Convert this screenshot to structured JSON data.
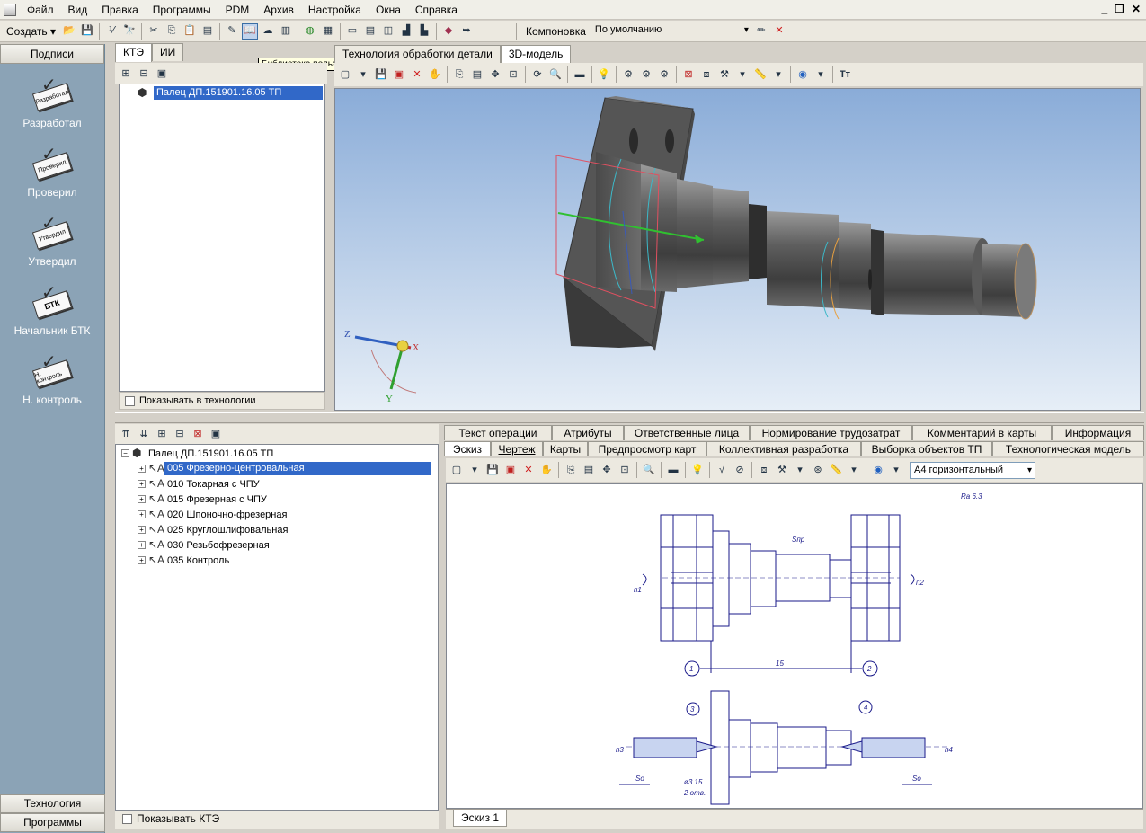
{
  "menu": {
    "items": [
      "Файл",
      "Вид",
      "Правка",
      "Программы",
      "PDM",
      "Архив",
      "Настройка",
      "Окна",
      "Справка"
    ]
  },
  "toolbar": {
    "create_label": "Создать",
    "layout_label": "Компоновка",
    "layout_value": "По умолчанию"
  },
  "tooltip": "Библиотека пользователей",
  "sidebar": {
    "header": "Подписи",
    "items": [
      {
        "label": "Разработал",
        "stamp": "Разработал"
      },
      {
        "label": "Проверил",
        "stamp": "Проверил"
      },
      {
        "label": "Утвердил",
        "stamp": "Утвердил"
      },
      {
        "label": "Начальник БТК",
        "stamp": "БТК"
      },
      {
        "label": "Н. контроль",
        "stamp": "Н. контроль"
      }
    ],
    "footer_tabs": [
      "Технология",
      "Программы"
    ]
  },
  "top_tabs": [
    "КТЭ",
    "ИИ"
  ],
  "top_tree": {
    "root": "Палец ДП.151901.16.05  ТП",
    "show_in_tech": "Показывать в технологии"
  },
  "viewer_tabs": [
    "Технология обработки детали",
    "3D-модель"
  ],
  "axes": {
    "z": "Z",
    "x": "X",
    "y": "Y"
  },
  "bottom_tree": {
    "root": "Палец ДП.151901.16.05  ТП",
    "operations": [
      "005  Фрезерно-центровальная",
      "010  Токарная  с  ЧПУ",
      "015  Фрезерная  с  ЧПУ",
      "020  Шпоночно-фрезерная",
      "025  Круглошлифовальная",
      "030  Резьбофрезерная",
      "035  Контроль"
    ],
    "show_kte": "Показывать КТЭ"
  },
  "right_tabs_row1": [
    "Текст операции",
    "Атрибуты",
    "Ответственные лица",
    "Нормирование трудозатрат",
    "Комментарий в карты",
    "Информация"
  ],
  "right_tabs_row2": [
    "Эскиз",
    "Чертеж",
    "Карты",
    "Предпросмотр карт",
    "Коллективная разработка",
    "Выборка объектов ТП",
    "Технологическая модель"
  ],
  "sketch": {
    "format_value": "А4 горизонтальный",
    "sheet_tab": "Эскиз 1",
    "roughness": "Ra 6.3",
    "labels": {
      "n1": "п1",
      "n2": "п2",
      "n3": "п3",
      "n4": "п4",
      "snp": "Sпр",
      "dim15": "15",
      "c1": "1",
      "c2": "2",
      "c3": "3",
      "c4": "4",
      "so_left": "Sо",
      "so_right": "Sо",
      "hole": "ø3.15",
      "holes": "2 отв."
    }
  },
  "colors": {
    "selection": "#3168c8",
    "sidebar": "#8ba3b6",
    "drawing_line": "#1a1a8a"
  }
}
